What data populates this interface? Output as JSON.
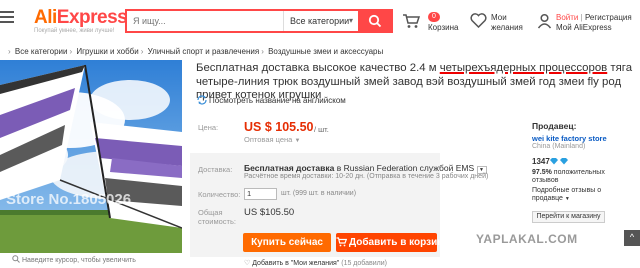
{
  "header": {
    "logo": {
      "brand_part1": "Ali",
      "brand_part2": "Express",
      "tagline": "Покупай умнее, живи лучше!"
    },
    "search": {
      "placeholder": "Я ищу...",
      "category": "Все категории"
    },
    "cart": {
      "count": "0",
      "label": "Корзина"
    },
    "wishlist": {
      "line1": "Мои",
      "line2": "желания"
    },
    "account": {
      "login": "Войти",
      "separator": "|",
      "register": "Регистрация",
      "name": "Мой AliExpress"
    },
    "accent_color": "#ff4747"
  },
  "breadcrumb": [
    "Все категории",
    "Игрушки и хобби",
    "Уличный спорт и развлечения",
    "Воздушные змеи и аксессуары"
  ],
  "image": {
    "caption": "Наведите курсор, чтобы увеличить",
    "watermark": "Store No.1805026"
  },
  "product": {
    "title_before": "Бесплатная доставка высокое качество 2.4 м ",
    "title_highlight": "четырехъядерных процессоров",
    "title_after": " тяга четыре-линия трюк воздушный змей завод вэй воздушный змей год змеи fly род привет котенок игрушки",
    "translate_link": "Посмотреть название на английском",
    "price_label": "Цена:",
    "price": "US $ 105.50",
    "price_unit": "/ шт.",
    "wholesale": "Оптовая цена",
    "shipping_label": "Доставка:",
    "shipping_free": "Бесплатная доставка",
    "shipping_dest": " в Russian Federation службой EMS",
    "shipping_sub": "Расчётное время доставки: 10-20 дн. (Отправка в течение 3 рабочих дней)",
    "qty_label": "Количество:",
    "qty_value": "1",
    "qty_note": "шт. (999 шт. в наличии)",
    "total_label_1": "Общая",
    "total_label_2": "стоимость:",
    "total": "US $105.50",
    "buy_now": "Купить сейчас",
    "add_to_cart": "Добавить в корзину",
    "wish_add": "Добавить в \"Мои желания\"",
    "wish_count": "(15 добавили)",
    "price_color": "#e62e04"
  },
  "seller": {
    "heading": "Продавец:",
    "name": "wei kite factory store",
    "country": "China (Mainland)",
    "score": "1347",
    "feedback_pct": "97.5%",
    "feedback_text": " положительных отзывов",
    "similar_1": "Подробные отзывы о",
    "similar_2": "продавце",
    "store_button": "Перейти к магазину"
  },
  "watermark": "YAPLAKAL.COM"
}
